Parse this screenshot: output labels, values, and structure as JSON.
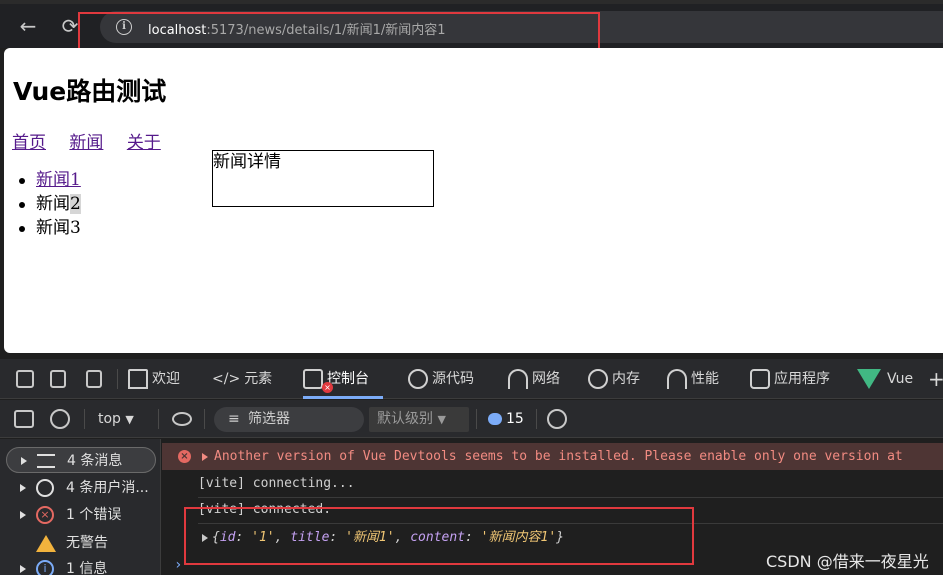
{
  "browser": {
    "back_icon": "arrow-left-icon",
    "reload_icon": "reload-icon",
    "url_host": "localhost",
    "url_path": ":5173/news/details/1/新闻1/新闻内容1"
  },
  "page": {
    "title": "Vue路由测试",
    "nav": [
      "首页",
      "新闻",
      "关于"
    ],
    "news_items": {
      "item1": "新闻1",
      "item2_prefix": "新闻",
      "item2_suffix": "2",
      "item3": "新闻3"
    },
    "detail_text": "新闻详情"
  },
  "devtools": {
    "tabs": {
      "welcome": "欢迎",
      "elements": "元素",
      "console": "控制台",
      "sources": "源代码",
      "network": "网络",
      "memory": "内存",
      "performance": "性能",
      "application": "应用程序",
      "vue": "Vue"
    },
    "toolbar": {
      "context": "top",
      "filter_label": "筛选器",
      "level_label": "默认级别",
      "issue_count": "15"
    },
    "sidebar": {
      "messages": "4 条消息",
      "user_messages": "4 条用户消...",
      "errors": "1 个错误",
      "warnings": "无警告",
      "info": "1 信息"
    },
    "log": {
      "error_text": "Another version of Vue Devtools seems to be installed. Please enable only one version at",
      "line1": "[vite] connecting...",
      "line2": "[vite] connected.",
      "obj_open": "{",
      "id_key": "id",
      "id_val": "'1'",
      "title_key": "title",
      "title_val": "'新闻1'",
      "content_key": "content",
      "content_val": "'新闻内容1'",
      "obj_close": "}",
      "sep": ": ",
      "comma": ", "
    }
  },
  "watermark": "CSDN @借来一夜星光",
  "colors": {
    "highlight_box": "#e0393e",
    "link": "#551a8b",
    "active_tab": "#7cacf8"
  }
}
